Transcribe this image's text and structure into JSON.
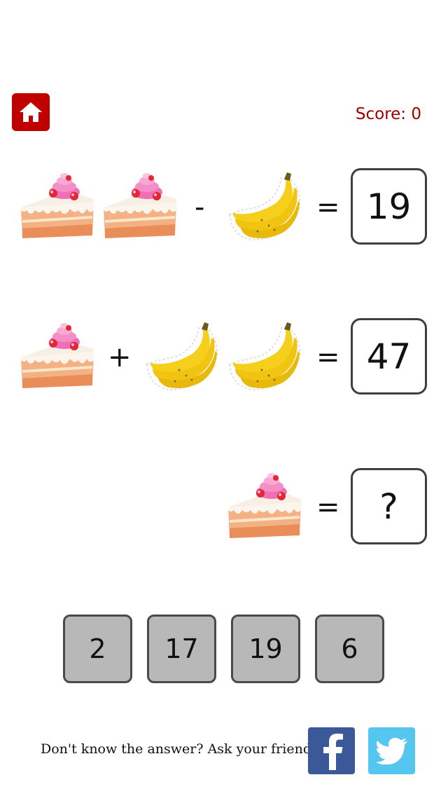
{
  "header": {
    "home_icon": "house-icon",
    "score_text": "Score: 0"
  },
  "puzzle": {
    "row1": {
      "items": [
        "cake",
        "cake",
        "banana"
      ],
      "operator": "-",
      "equals": "=",
      "result": "19"
    },
    "row2": {
      "items": [
        "cake",
        "banana",
        "banana"
      ],
      "operator": "+",
      "equals": "=",
      "result": "47"
    },
    "row3": {
      "items": [
        "cake"
      ],
      "equals": "=",
      "result": "?"
    }
  },
  "choices": [
    "2",
    "17",
    "19",
    "6"
  ],
  "footer": {
    "ask_text": "Don't know the answer? Ask your friends",
    "facebook_icon": "facebook-icon",
    "twitter_icon": "twitter-icon"
  },
  "colors": {
    "home_bg": "#c00000",
    "score": "#9a0000",
    "choice_bg": "#b8b8b8",
    "facebook": "#3b5998",
    "twitter": "#55c6ef"
  }
}
